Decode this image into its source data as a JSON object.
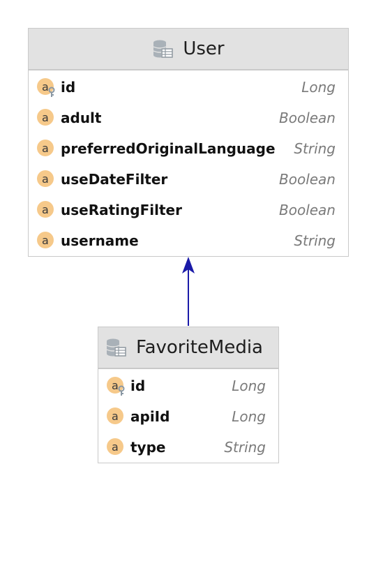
{
  "diagram": {
    "colors": {
      "header_bg": "#e2e2e2",
      "border": "#c9c9c9",
      "attr_icon_fill": "#f6c98a",
      "key_icon": "#8a98a4",
      "arrow": "#1a1aa8",
      "type_text": "#7a7a7a"
    },
    "entities": [
      {
        "id": "user",
        "icon": "database-table-icon",
        "name": "User",
        "attributes": [
          {
            "name": "id",
            "type": "Long",
            "icon": "attribute-key-icon"
          },
          {
            "name": "adult",
            "type": "Boolean",
            "icon": "attribute-icon"
          },
          {
            "name": "preferredOriginalLanguage",
            "type": "String",
            "icon": "attribute-icon"
          },
          {
            "name": "useDateFilter",
            "type": "Boolean",
            "icon": "attribute-icon"
          },
          {
            "name": "useRatingFilter",
            "type": "Boolean",
            "icon": "attribute-icon"
          },
          {
            "name": "username",
            "type": "String",
            "icon": "attribute-icon"
          }
        ]
      },
      {
        "id": "favorite-media",
        "icon": "database-table-icon",
        "name": "FavoriteMedia",
        "attributes": [
          {
            "name": "id",
            "type": "Long",
            "icon": "attribute-key-icon"
          },
          {
            "name": "apiId",
            "type": "Long",
            "icon": "attribute-icon"
          },
          {
            "name": "type",
            "type": "String",
            "icon": "attribute-icon"
          }
        ]
      }
    ],
    "relations": [
      {
        "from": "favorite-media",
        "to": "user",
        "kind": "arrow"
      }
    ]
  }
}
